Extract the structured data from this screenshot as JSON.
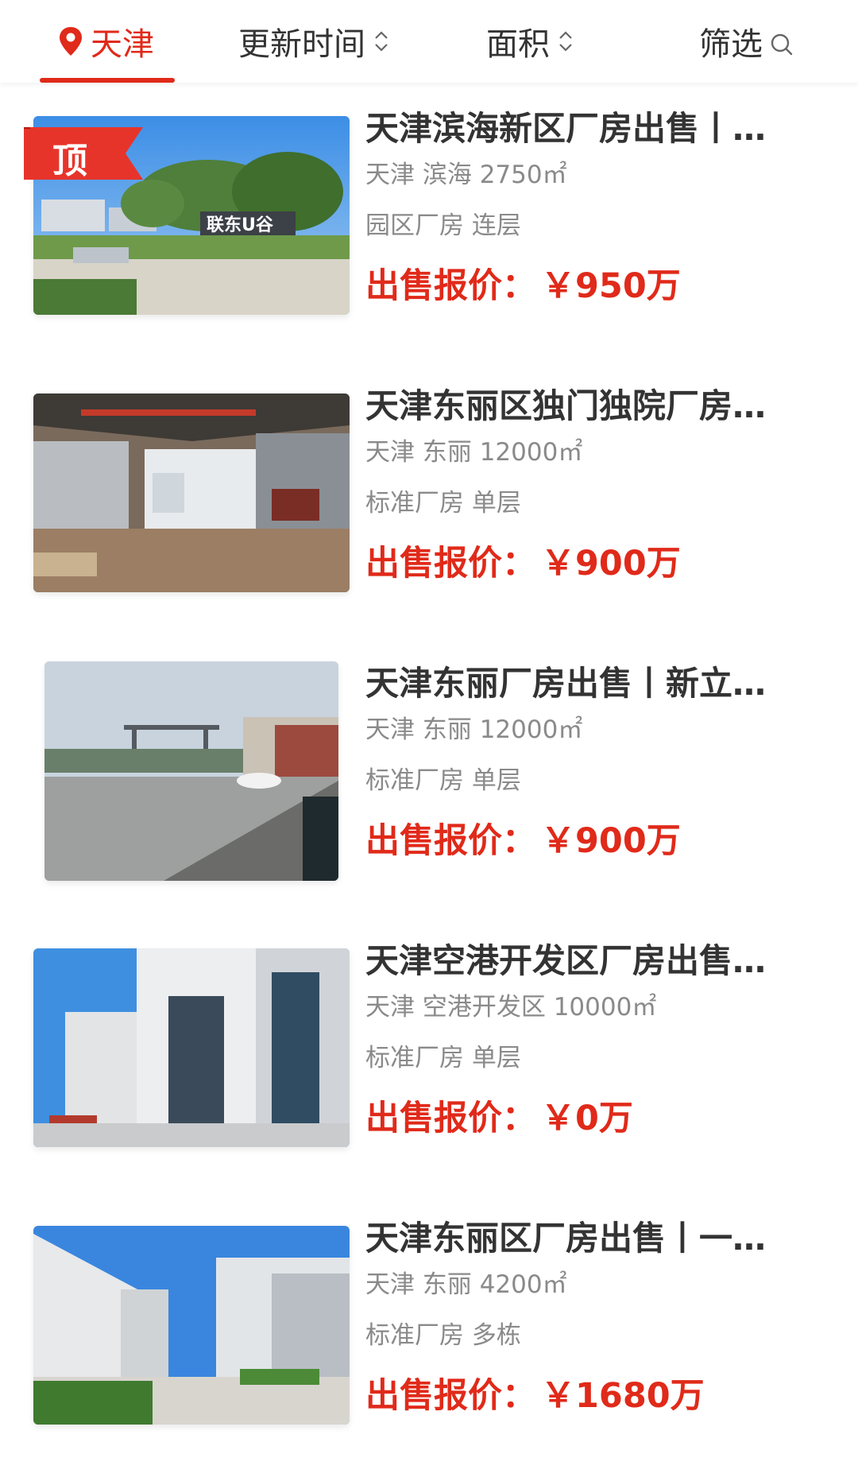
{
  "header": {
    "city_label": "天津",
    "sort_update_label": "更新时间",
    "sort_area_label": "面积",
    "filter_label": "筛选",
    "accent_color": "#e02a1a"
  },
  "top_badge": "顶",
  "listings": [
    {
      "title": "天津滨海新区厂房出售丨…",
      "location": "天津 滨海 2750㎡",
      "type": "园区厂房 连层",
      "price_label": "出售报价：",
      "price": "￥950万",
      "pinned": true
    },
    {
      "title": "天津东丽区独门独院厂房…",
      "location": "天津 东丽 12000㎡",
      "type": "标准厂房 单层",
      "price_label": "出售报价：",
      "price": "￥900万",
      "pinned": false
    },
    {
      "title": "天津东丽厂房出售丨新立…",
      "location": "天津 东丽 12000㎡",
      "type": "标准厂房 单层",
      "price_label": "出售报价：",
      "price": "￥900万",
      "pinned": false
    },
    {
      "title": "天津空港开发区厂房出售…",
      "location": "天津 空港开发区 10000㎡",
      "type": "标准厂房 单层",
      "price_label": "出售报价：",
      "price": "￥0万",
      "pinned": false
    },
    {
      "title": "天津东丽区厂房出售丨一…",
      "location": "天津 东丽 4200㎡",
      "type": "标准厂房 多栋",
      "price_label": "出售报价：",
      "price": "￥1680万",
      "pinned": false
    }
  ]
}
